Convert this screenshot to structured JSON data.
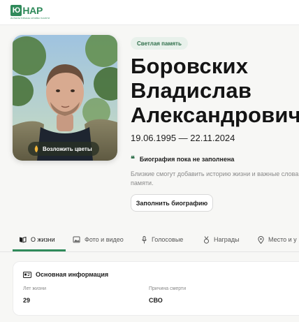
{
  "logo": {
    "box_text": "Ю",
    "word": "НАР",
    "tagline": "ИНТЕРАКТИВНЫЕ АРХИВЫ ПАМЯТИ"
  },
  "profile": {
    "badge": "Светлая память",
    "name_lines": [
      "Боровских",
      "Владислав",
      "Александрович"
    ],
    "dates": "19.06.1995 — 22.11.2024",
    "flowers_button": "Возложить цветы"
  },
  "biography": {
    "title": "Биография пока не заполнена",
    "description": "Близкие смогут добавить историю жизни и важные слова памяти.",
    "fill_button": "Заполнить биографию"
  },
  "tabs": [
    {
      "label": "О жизни",
      "icon": "book-icon",
      "active": true
    },
    {
      "label": "Фото и видео",
      "icon": "photo-icon",
      "active": false
    },
    {
      "label": "Голосовые",
      "icon": "microphone-icon",
      "active": false
    },
    {
      "label": "Награды",
      "icon": "medal-icon",
      "active": false
    },
    {
      "label": "Место и у",
      "icon": "location-pin-icon",
      "active": false
    }
  ],
  "info_card": {
    "title": "Основная информация",
    "fields": [
      {
        "label": "Лет жизни",
        "value": "29"
      },
      {
        "label": "Причина смерти",
        "value": "СВО"
      }
    ]
  },
  "colors": {
    "accent": "#2f8a5a",
    "badge_bg": "#e8f1eb",
    "page_bg": "#f7f7f5"
  }
}
